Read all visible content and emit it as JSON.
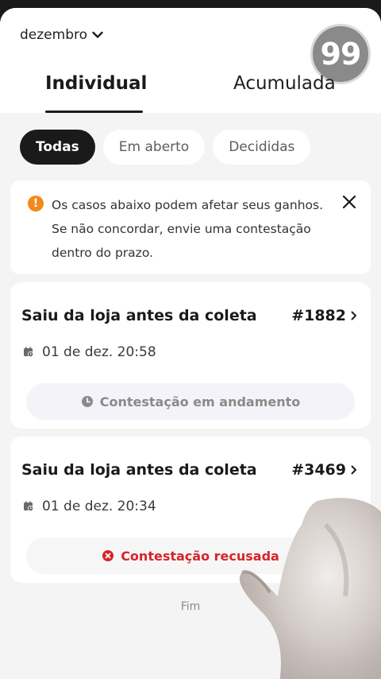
{
  "header": {
    "month": "dezembro",
    "logo_text": "99"
  },
  "tabs": [
    {
      "label": "Individual",
      "active": true
    },
    {
      "label": "Acumulada",
      "active": false
    }
  ],
  "filters": [
    {
      "label": "Todas",
      "active": true
    },
    {
      "label": "Em aberto",
      "active": false
    },
    {
      "label": "Decididas",
      "active": false
    }
  ],
  "notice": {
    "text": "Os casos abaixo podem afetar seus ganhos. Se não concordar, envie uma contestação dentro do prazo.",
    "icon": "warning-icon",
    "color": "#f08a1d"
  },
  "cases": [
    {
      "title": "Saiu da loja antes da coleta",
      "id": "#1882",
      "datetime": "01 de dez. 20:58",
      "status": "Contestação em andamento",
      "status_icon": "clock-icon",
      "status_color": "#8a8a8a"
    },
    {
      "title": "Saiu da loja antes da coleta",
      "id": "#3469",
      "datetime": "01 de dez. 20:34",
      "status": "Contestação recusada",
      "status_icon": "x-circle-icon",
      "status_color": "#d6242a"
    }
  ],
  "footer": {
    "end_text": "Fim"
  }
}
